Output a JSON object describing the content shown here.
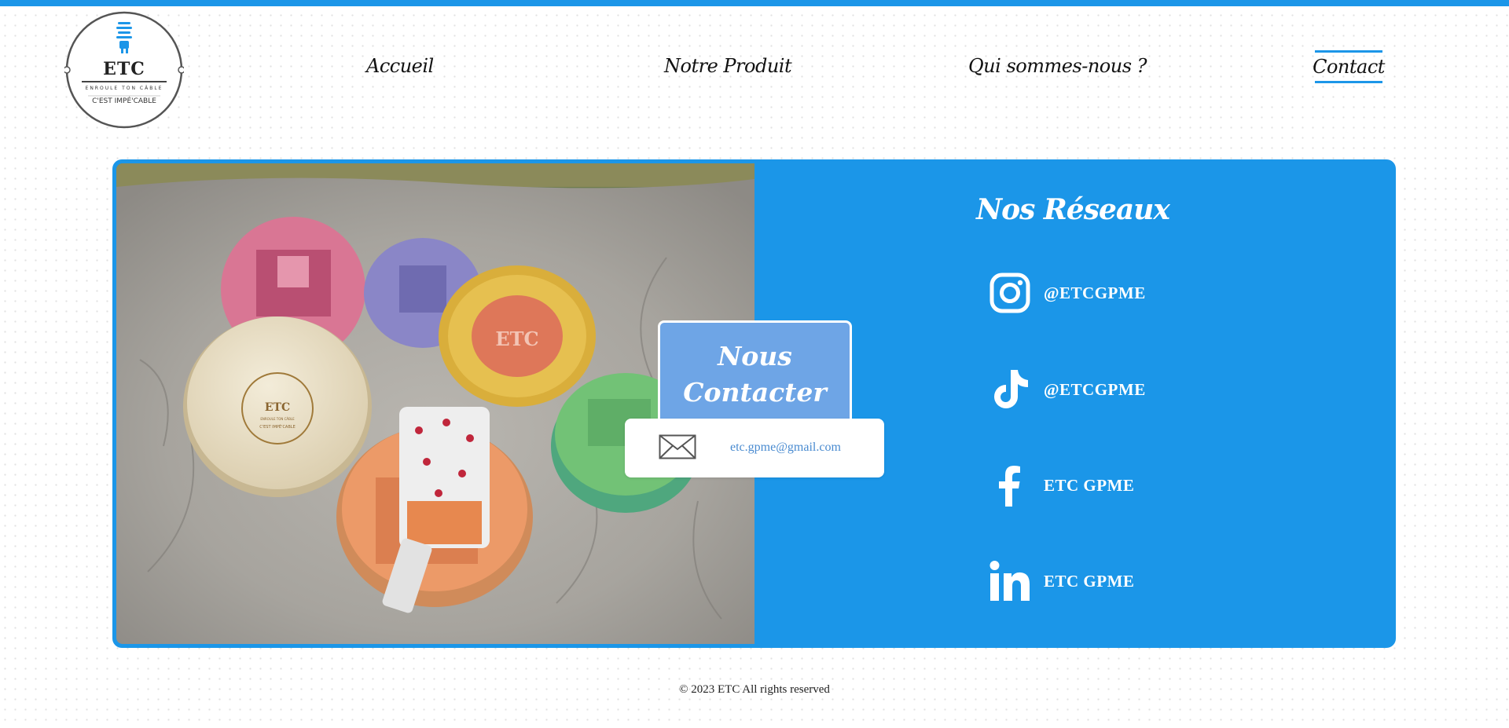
{
  "header": {
    "logo": {
      "title": "ETC",
      "subtitle": "ENROULE TON CÂBLE",
      "tagline": "C'EST IMPÉ'CABLE"
    },
    "nav": [
      {
        "label": "Accueil"
      },
      {
        "label": "Notre Produit"
      },
      {
        "label": "Qui sommes-nous ?"
      },
      {
        "label": "Contact",
        "active": true
      }
    ]
  },
  "photo": {
    "alt": "Colorful 3D-printed cable winders on a tree stump",
    "lid_label": "ETC",
    "lid_sub": "ENROULE TON CÂBLE",
    "lid_tag": "C'EST IMPÉ'CABLE",
    "lid_label_2": "ETC"
  },
  "contact": {
    "title_line1": "Nous",
    "title_line2": "Contacter",
    "email": "etc.gpme@gmail.com"
  },
  "networks": {
    "title": "Nos Réseaux",
    "items": [
      {
        "icon": "instagram-icon",
        "label": "@ETCGPME"
      },
      {
        "icon": "tiktok-icon",
        "label": "@ETCGPME"
      },
      {
        "icon": "facebook-icon",
        "label": "ETC GPME"
      },
      {
        "icon": "linkedin-icon",
        "label": "ETC GPME"
      }
    ]
  },
  "footer": {
    "text": "© 2023 ETC All rights reserved"
  },
  "colors": {
    "accent": "#1c96e8",
    "contact_box": "#6ea5e6",
    "email_text": "#4a8bd0"
  }
}
